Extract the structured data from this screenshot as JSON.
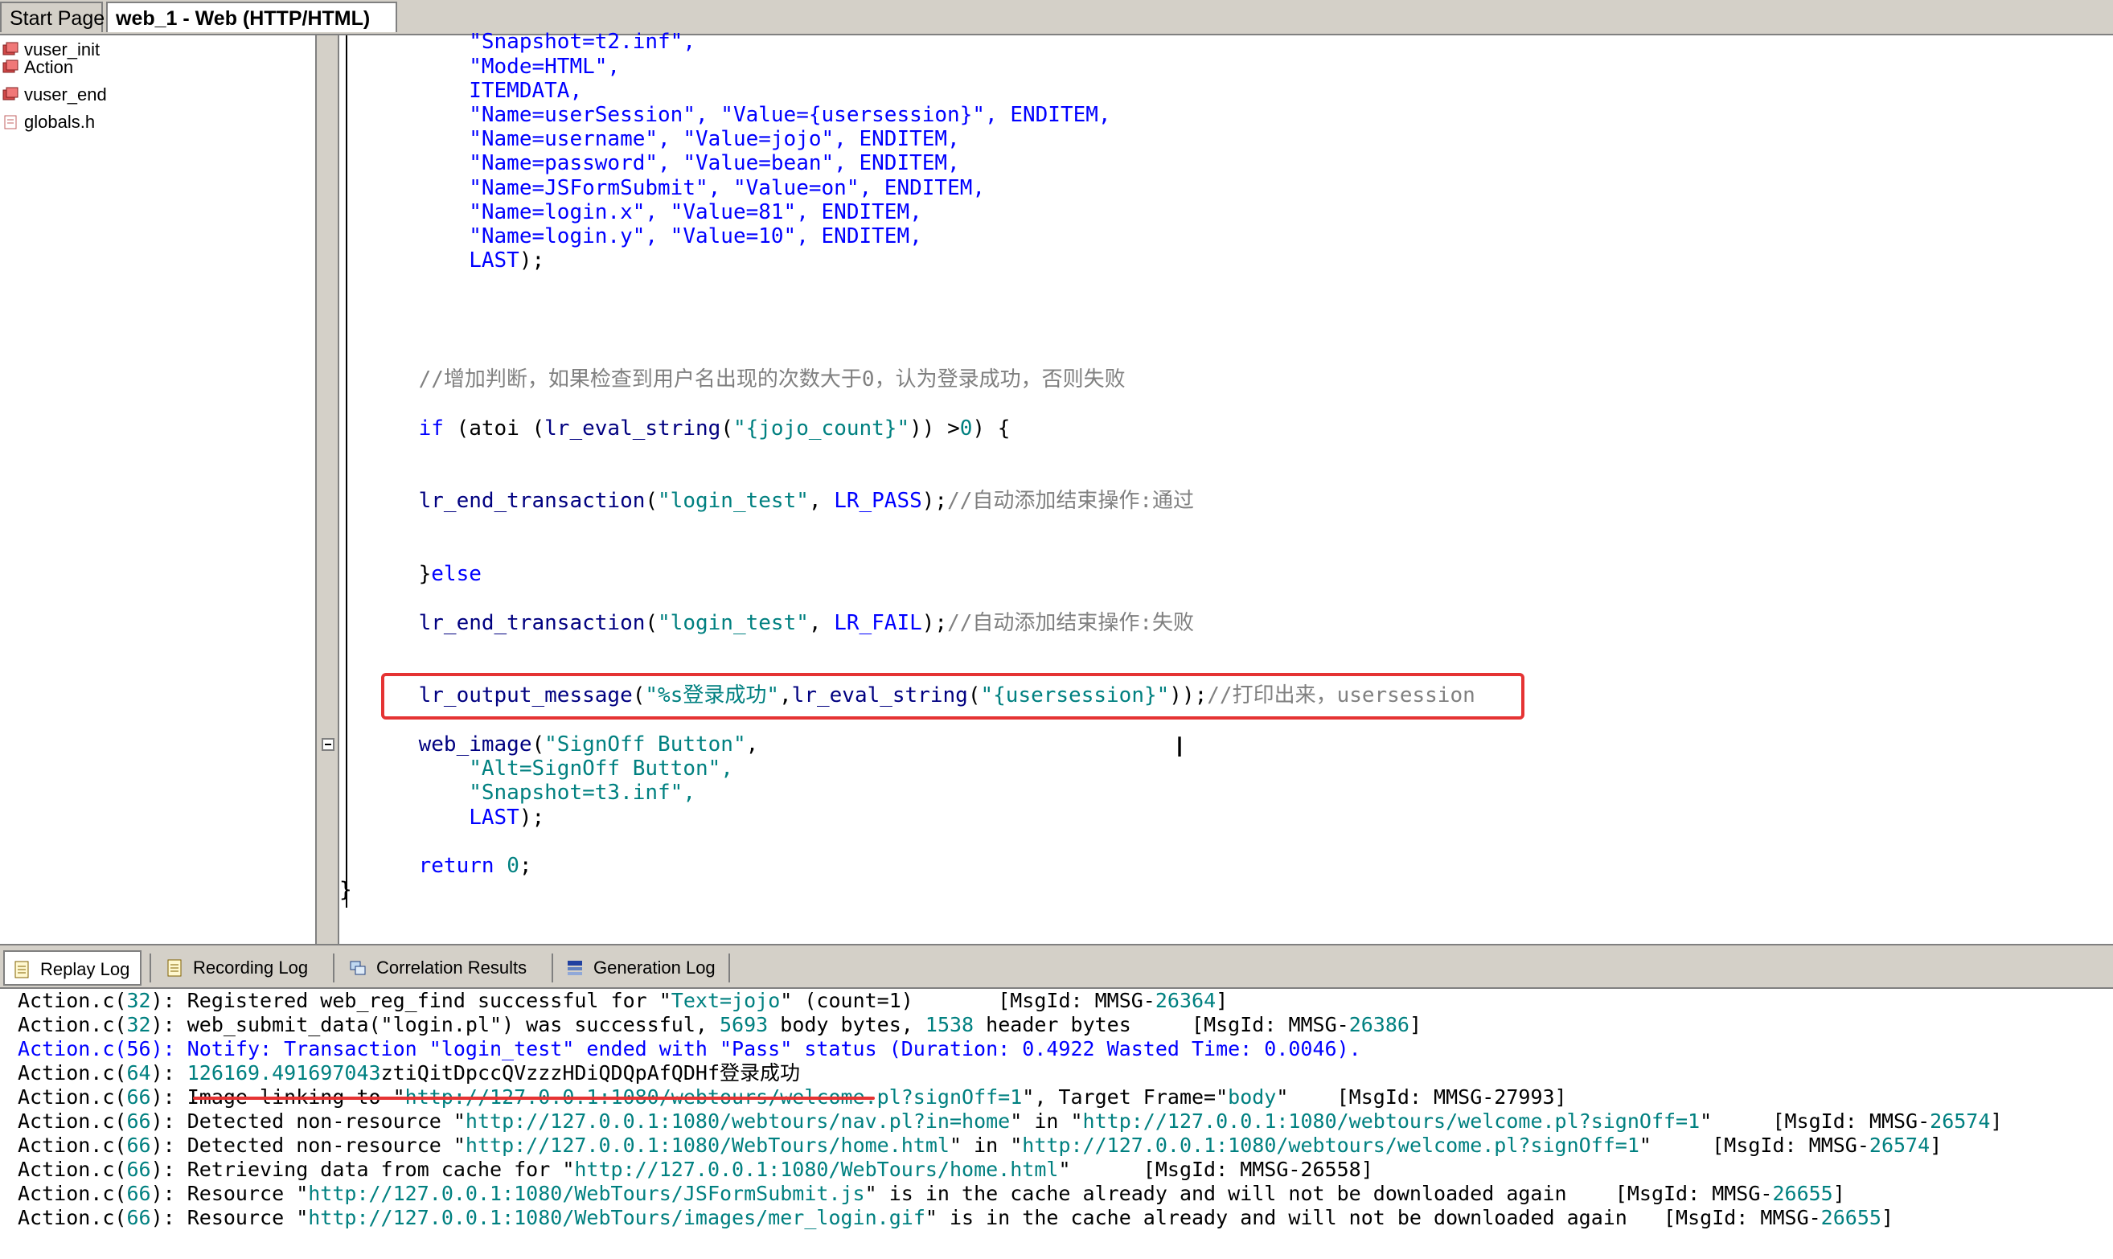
{
  "tabs": {
    "start": "Start Page",
    "active": "web_1 - Web (HTTP/HTML)"
  },
  "tree": [
    {
      "label": "vuser_init",
      "icon": "script-icon"
    },
    {
      "label": "Action",
      "icon": "script-icon"
    },
    {
      "label": "vuser_end",
      "icon": "script-icon"
    },
    {
      "label": "globals.h",
      "icon": "header-file-icon"
    }
  ],
  "code": [
    [
      {
        "t": "        \"Snapshot=t2.inf\",",
        "k": "s"
      }
    ],
    [
      {
        "t": "        \"Mode=HTML\",",
        "k": "s"
      }
    ],
    [
      {
        "t": "        ITEMDATA,",
        "k": "kw"
      }
    ],
    [
      {
        "t": "        \"Name=userSession\", \"Value={usersession}\", ",
        "k": "s"
      },
      {
        "t": "ENDITEM,",
        "k": "kw"
      }
    ],
    [
      {
        "t": "        \"Name=username\", \"Value=jojo\", ",
        "k": "s"
      },
      {
        "t": "ENDITEM,",
        "k": "kw"
      }
    ],
    [
      {
        "t": "        \"Name=password\", \"Value=bean\", ",
        "k": "s"
      },
      {
        "t": "ENDITEM,",
        "k": "kw"
      }
    ],
    [
      {
        "t": "        \"Name=JSFormSubmit\", \"Value=on\", ",
        "k": "s"
      },
      {
        "t": "ENDITEM,",
        "k": "kw"
      }
    ],
    [
      {
        "t": "        \"Name=login.x\", \"Value=81\", ",
        "k": "s"
      },
      {
        "t": "ENDITEM,",
        "k": "kw"
      }
    ],
    [
      {
        "t": "        \"Name=login.y\", \"Value=10\", ",
        "k": "s"
      },
      {
        "t": "ENDITEM,",
        "k": "kw"
      }
    ],
    [
      {
        "t": "        LAST",
        "k": "kw"
      },
      {
        "t": ");",
        "k": ""
      }
    ],
    [
      {
        "t": "    //增加判断，如果检查到用户名出现的次数大于0，认为登录成功，否则失败",
        "k": "c"
      }
    ],
    [
      {
        "t": "    if",
        "k": "kw"
      },
      {
        "t": " (atoi (",
        "k": ""
      },
      {
        "t": "lr_eval_string",
        "k": "fn"
      },
      {
        "t": "(",
        "k": ""
      },
      {
        "t": "\"{jojo_count}\"",
        "k": "str"
      },
      {
        "t": ")) >",
        "k": ""
      },
      {
        "t": "0",
        "k": "str"
      },
      {
        "t": ") {",
        "k": ""
      }
    ],
    [
      {
        "t": "    lr_end_transaction",
        "k": "fn"
      },
      {
        "t": "(",
        "k": ""
      },
      {
        "t": "\"login_test\"",
        "k": "str"
      },
      {
        "t": ", ",
        "k": ""
      },
      {
        "t": "LR_PASS",
        "k": "kw"
      },
      {
        "t": ");",
        "k": ""
      },
      {
        "t": "//自动添加结束操作:通过",
        "k": "c"
      }
    ],
    [
      {
        "t": "    }",
        "k": ""
      },
      {
        "t": "else",
        "k": "kw"
      }
    ],
    [
      {
        "t": "    lr_end_transaction",
        "k": "fn"
      },
      {
        "t": "(",
        "k": ""
      },
      {
        "t": "\"login_test\"",
        "k": "str"
      },
      {
        "t": ", ",
        "k": ""
      },
      {
        "t": "LR_FAIL",
        "k": "kw"
      },
      {
        "t": ");",
        "k": ""
      },
      {
        "t": "//自动添加结束操作:失败",
        "k": "c"
      }
    ],
    [
      {
        "t": "    lr_output_message",
        "k": "fn"
      },
      {
        "t": "(",
        "k": ""
      },
      {
        "t": "\"%s登录成功\"",
        "k": "str"
      },
      {
        "t": ",",
        "k": ""
      },
      {
        "t": "lr_eval_string",
        "k": "fn"
      },
      {
        "t": "(",
        "k": ""
      },
      {
        "t": "\"{usersession}\"",
        "k": "str"
      },
      {
        "t": "));",
        "k": ""
      },
      {
        "t": "//打印出来，usersession",
        "k": "c"
      }
    ],
    [
      {
        "t": "    web_image",
        "k": "fn"
      },
      {
        "t": "(",
        "k": ""
      },
      {
        "t": "\"SignOff Button\"",
        "k": "str"
      },
      {
        "t": ",",
        "k": ""
      }
    ],
    [
      {
        "t": "        \"Alt=SignOff Button\",",
        "k": "str"
      }
    ],
    [
      {
        "t": "        \"Snapshot=t3.inf\",",
        "k": "str"
      }
    ],
    [
      {
        "t": "        LAST",
        "k": "kw"
      },
      {
        "t": ");",
        "k": ""
      }
    ],
    [
      {
        "t": "    return",
        "k": "kw"
      },
      {
        "t": " ",
        "k": ""
      },
      {
        "t": "0",
        "k": "str"
      },
      {
        "t": ";",
        "k": ""
      }
    ],
    [
      {
        "t": "}",
        "k": ""
      }
    ]
  ],
  "outtabs": [
    "Replay Log",
    "Recording Log",
    "Correlation Results",
    "Generation Log"
  ],
  "log": [
    [
      {
        "t": "Action.c(",
        "k": ""
      },
      {
        "t": "32",
        "k": "ll"
      },
      {
        "t": "): Registered web_reg_find successful for \"",
        "k": ""
      },
      {
        "t": "Text=jojo",
        "k": "ll"
      },
      {
        "t": "\" (count=1)       [MsgId: MMSG-",
        "k": ""
      },
      {
        "t": "26364",
        "k": "ll"
      },
      {
        "t": "]",
        "k": ""
      }
    ],
    [
      {
        "t": "Action.c(",
        "k": ""
      },
      {
        "t": "32",
        "k": "ll"
      },
      {
        "t": "): web_submit_data(\"login.pl\") was successful, ",
        "k": ""
      },
      {
        "t": "5693",
        "k": "ll"
      },
      {
        "t": " body bytes, ",
        "k": ""
      },
      {
        "t": "1538",
        "k": "ll"
      },
      {
        "t": " header bytes     [MsgId: MMSG-",
        "k": ""
      },
      {
        "t": "26386",
        "k": "ll"
      },
      {
        "t": "]",
        "k": ""
      }
    ],
    [
      {
        "t": "Action.c(56): Notify: Transaction \"login_test\" ended with \"Pass\" status (Duration: 0.4922 Wasted Time: 0.0046).",
        "k": "lb"
      }
    ],
    [
      {
        "t": "Action.c(",
        "k": ""
      },
      {
        "t": "64",
        "k": "ll"
      },
      {
        "t": "): ",
        "k": ""
      },
      {
        "t": "126169.491697043",
        "k": "ll"
      },
      {
        "t": "ztiQitDpccQVzzzHDiQDQpAfQDHf登录成功",
        "k": ""
      }
    ],
    [
      {
        "t": "Action.c(",
        "k": ""
      },
      {
        "t": "66",
        "k": "ll"
      },
      {
        "t": "): Image-linking to \"",
        "k": ""
      },
      {
        "t": "http://127.0.0.1:1080/webtours/welcome.pl?signOff=1",
        "k": "ll"
      },
      {
        "t": "\", Target Frame=\"",
        "k": ""
      },
      {
        "t": "body",
        "k": "ll"
      },
      {
        "t": "\"    [MsgId: MMSG-27993]",
        "k": ""
      }
    ],
    [
      {
        "t": "Action.c(",
        "k": ""
      },
      {
        "t": "66",
        "k": "ll"
      },
      {
        "t": "): Detected non-resource \"",
        "k": ""
      },
      {
        "t": "http://127.0.0.1:1080/webtours/nav.pl?in=home",
        "k": "ll"
      },
      {
        "t": "\" in \"",
        "k": ""
      },
      {
        "t": "http://127.0.0.1:1080/webtours/welcome.pl?signOff=1",
        "k": "ll"
      },
      {
        "t": "\"     [MsgId: MMSG-",
        "k": ""
      },
      {
        "t": "26574",
        "k": "ll"
      },
      {
        "t": "]",
        "k": ""
      }
    ],
    [
      {
        "t": "Action.c(",
        "k": ""
      },
      {
        "t": "66",
        "k": "ll"
      },
      {
        "t": "): Detected non-resource \"",
        "k": ""
      },
      {
        "t": "http://127.0.0.1:1080/WebTours/home.html",
        "k": "ll"
      },
      {
        "t": "\" in \"",
        "k": ""
      },
      {
        "t": "http://127.0.0.1:1080/webtours/welcome.pl?signOff=1",
        "k": "ll"
      },
      {
        "t": "\"     [MsgId: MMSG-",
        "k": ""
      },
      {
        "t": "26574",
        "k": "ll"
      },
      {
        "t": "]",
        "k": ""
      }
    ],
    [
      {
        "t": "Action.c(",
        "k": ""
      },
      {
        "t": "66",
        "k": "ll"
      },
      {
        "t": "): Retrieving data from cache for \"",
        "k": ""
      },
      {
        "t": "http://127.0.0.1:1080/WebTours/home.html",
        "k": "ll"
      },
      {
        "t": "\"      [MsgId: MMSG-26558]",
        "k": ""
      }
    ],
    [
      {
        "t": "Action.c(",
        "k": ""
      },
      {
        "t": "66",
        "k": "ll"
      },
      {
        "t": "): Resource \"",
        "k": ""
      },
      {
        "t": "http://127.0.0.1:1080/WebTours/JSFormSubmit.js",
        "k": "ll"
      },
      {
        "t": "\" is in the cache already and will not be downloaded again    [MsgId: MMSG-",
        "k": ""
      },
      {
        "t": "26655",
        "k": "ll"
      },
      {
        "t": "]",
        "k": ""
      }
    ],
    [
      {
        "t": "Action.c(",
        "k": ""
      },
      {
        "t": "66",
        "k": "ll"
      },
      {
        "t": "): Resource \"",
        "k": ""
      },
      {
        "t": "http://127.0.0.1:1080/WebTours/images/mer_login.gif",
        "k": "ll"
      },
      {
        "t": "\" is in the cache already and will not be downloaded again   [MsgId: MMSG-",
        "k": ""
      },
      {
        "t": "26655",
        "k": "ll"
      },
      {
        "t": "]",
        "k": ""
      }
    ]
  ]
}
